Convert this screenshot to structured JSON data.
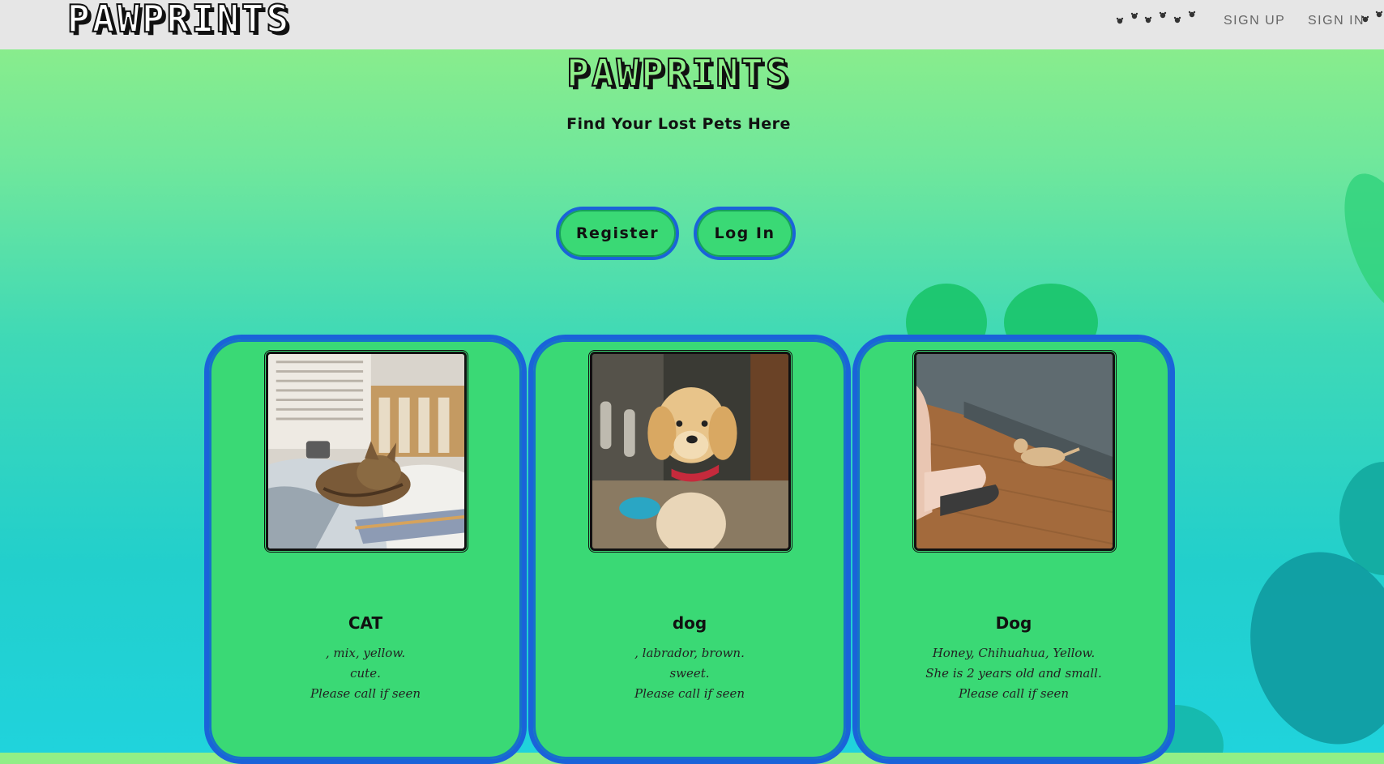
{
  "navbar": {
    "logo": "PAWPRINTS",
    "links": [
      {
        "label": "SIGN UP"
      },
      {
        "label": "SIGN IN"
      }
    ],
    "icons": [
      "paw-trail-icon"
    ]
  },
  "hero": {
    "title": "PAWPRINTS",
    "subtitle": "Find Your Lost Pets Here",
    "buttons": {
      "register": "Register",
      "login": "Log In"
    }
  },
  "cards": [
    {
      "name": "CAT",
      "image": "cat-photo",
      "lines": [
        ", mix, yellow.",
        "cute.",
        "Please call if seen"
      ]
    },
    {
      "name": "dog",
      "image": "puppy-photo",
      "lines": [
        ", labrador, brown.",
        "sweet.",
        "Please call if seen"
      ]
    },
    {
      "name": "Dog",
      "image": "small-dog-photo",
      "lines": [
        "Honey, Chihuahua, Yellow.",
        "She is 2 years old and small.",
        "Please call if seen"
      ]
    }
  ],
  "colors": {
    "navbar_bg": "#e6e6e6",
    "card_bg": "#3ad975",
    "card_border": "#1a63d9",
    "gradient_top": "#93ef86",
    "gradient_bottom": "#20d3dc"
  }
}
